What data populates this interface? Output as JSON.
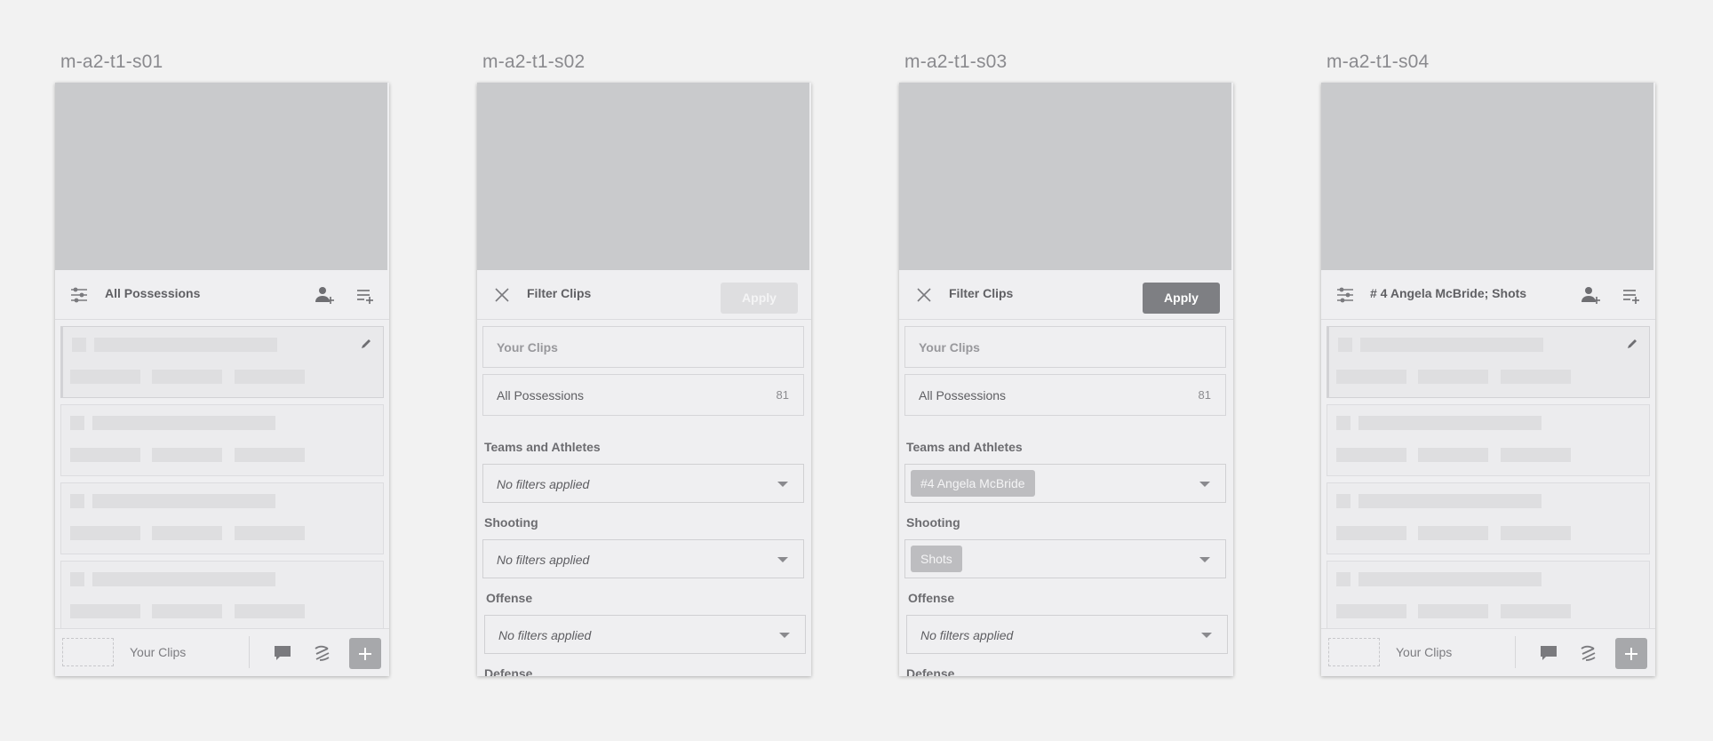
{
  "screens": [
    {
      "label": "m-a2-t1-s01",
      "header": {
        "title": "All Possessions"
      },
      "bottom": {
        "your_clips": "Your Clips"
      }
    },
    {
      "label": "m-a2-t1-s02",
      "header": {
        "title": "Filter Clips",
        "apply": "Apply",
        "apply_state": "disabled"
      },
      "your_clips": "Your Clips",
      "all_possessions": {
        "label": "All Possessions",
        "count": "81"
      },
      "sections": [
        {
          "title": "Teams and Athletes",
          "value": "No filters applied",
          "chip": null
        },
        {
          "title": "Shooting",
          "value": "No filters applied",
          "chip": null
        },
        {
          "title": "Offense",
          "value": "No filters applied",
          "chip": null
        },
        {
          "title": "Defense"
        }
      ]
    },
    {
      "label": "m-a2-t1-s03",
      "header": {
        "title": "Filter Clips",
        "apply": "Apply",
        "apply_state": "enabled"
      },
      "your_clips": "Your Clips",
      "all_possessions": {
        "label": "All Possessions",
        "count": "81"
      },
      "sections": [
        {
          "title": "Teams and Athletes",
          "value": null,
          "chip": "#4 Angela McBride"
        },
        {
          "title": "Shooting",
          "value": null,
          "chip": "Shots"
        },
        {
          "title": "Offense",
          "value": "No filters applied",
          "chip": null
        },
        {
          "title": "Defense"
        }
      ]
    },
    {
      "label": "m-a2-t1-s04",
      "header": {
        "title": "# 4 Angela McBride; Shots"
      },
      "bottom": {
        "your_clips": "Your Clips"
      }
    }
  ],
  "colors": {
    "background": "#f2f2f2",
    "video_placeholder": "#c9cacc",
    "panel": "#efeff1",
    "apply_enabled": "#7e7f83",
    "apply_disabled": "#dedee0",
    "chip": "#bdbdc0"
  },
  "icons": {
    "filter": "sliders-icon",
    "add_user": "add-person-icon",
    "add_to_playlist": "playlist-add-icon",
    "close": "close-icon",
    "edit": "pencil-icon",
    "comment": "comment-icon",
    "draw": "scribble-icon",
    "add": "plus-icon"
  }
}
